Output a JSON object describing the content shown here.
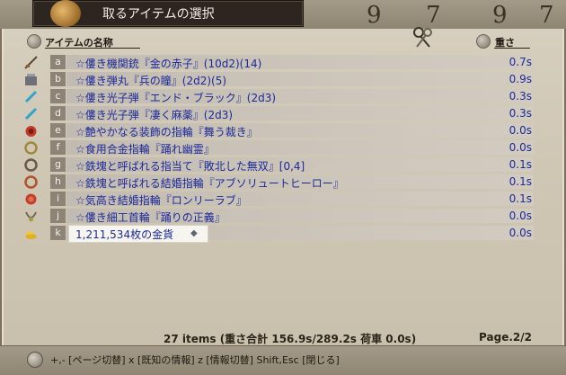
{
  "window": {
    "title": "取るアイテムの選択"
  },
  "header": {
    "name_label": "アイテムの名称",
    "weight_label": "重さ"
  },
  "items": [
    {
      "key": "a",
      "icon": "machine-gun-icon",
      "name": "☆僂き機関銃『金の赤子』(10d2)(14)",
      "weight": "0.7s"
    },
    {
      "key": "b",
      "icon": "ammo-icon",
      "name": "☆僂き弾丸『兵の瞳』(2d2)(5)",
      "weight": "0.9s"
    },
    {
      "key": "c",
      "icon": "photon-bullet-icon",
      "name": "☆僂き光子弾『エンド・ブラック』(2d3)",
      "weight": "0.3s"
    },
    {
      "key": "d",
      "icon": "photon-bullet-icon",
      "name": "☆僂き光子弾『凄く麻薬』(2d3)",
      "weight": "0.3s"
    },
    {
      "key": "e",
      "icon": "ring-icon",
      "name": "☆艶やかなる装飾の指輪『舞う裁き』",
      "weight": "0.0s"
    },
    {
      "key": "f",
      "icon": "ring-icon",
      "name": "☆食用合金指輪『踊れ幽霊』",
      "weight": "0.0s"
    },
    {
      "key": "g",
      "icon": "ring-icon",
      "name": "☆鉄塊と呼ばれる指当て『敗北した無双』[0,4]",
      "weight": "0.1s"
    },
    {
      "key": "h",
      "icon": "ring-icon",
      "name": "☆鉄塊と呼ばれる結婚指輪『アブソリュートヒーロー』",
      "weight": "0.1s"
    },
    {
      "key": "i",
      "icon": "ring-icon",
      "name": "☆気高き結婚指輪『ロンリーラブ』",
      "weight": "0.1s"
    },
    {
      "key": "j",
      "icon": "necklace-icon",
      "name": "☆僂き細工首輪『踊りの正義』",
      "weight": "0.0s"
    },
    {
      "key": "k",
      "icon": "gold-coins-icon",
      "name": "1,211,534枚の金貨",
      "weight": "0.0s"
    }
  ],
  "footer": {
    "summary": "27 items  (重さ合計 156.9s/289.2s  荷車 0.0s)",
    "page": "Page.2/2",
    "help": "+,- [ページ切替]  x [既知の情報]  z [情報切替]  Shift,Esc [閉じる]"
  },
  "colors": {
    "item_text": "#1c2a9a",
    "title_panel": "#2d2620",
    "background": "#d8d0c0"
  }
}
